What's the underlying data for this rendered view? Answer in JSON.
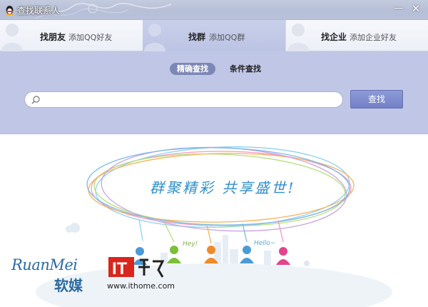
{
  "window": {
    "title": "查找联系人",
    "minimize_label": "—",
    "close_label": "✕"
  },
  "tabs": [
    {
      "title": "找朋友",
      "subtitle": "添加QQ好友",
      "active": false
    },
    {
      "title": "找群",
      "subtitle": "添加QQ群",
      "active": true
    },
    {
      "title": "找企业",
      "subtitle": "添加企业好友",
      "active": false
    }
  ],
  "search": {
    "modes": [
      "精确查找",
      "条件查找"
    ],
    "active_mode": "精确查找",
    "input_value": "",
    "input_placeholder": "",
    "button_label": "查找"
  },
  "illustration": {
    "slogan": "群聚精彩 共享盛世!",
    "labels": [
      "Hey!",
      "Hello~"
    ]
  },
  "watermarks": {
    "ruanmei_en": "RuanMei",
    "ruanmei_cn": "软媒",
    "ithome_url": "www.ithome.com"
  },
  "colors": {
    "accent": "#7380c6",
    "panel": "#c0c7e6",
    "active_tab": "#bcc4e4",
    "person_blue": "#4a9bd6",
    "person_green": "#7bbf3a",
    "person_orange": "#f08a2a",
    "person_pink": "#e2458c",
    "it_red": "#d9261c"
  },
  "icons": [
    "qq-penguin-icon",
    "search-icon",
    "person-silhouette-icon",
    "person-figure-icon"
  ]
}
